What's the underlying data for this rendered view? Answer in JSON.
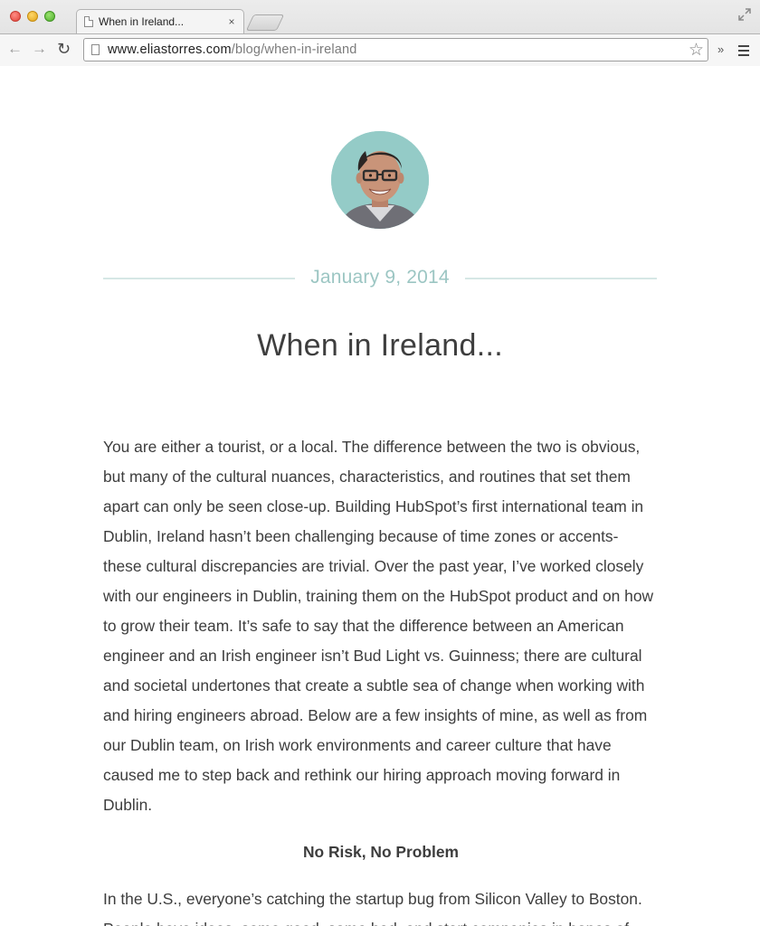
{
  "browser": {
    "tab_title": "When in Ireland...",
    "tab_close": "×",
    "url_domain": "www.eliastorres.com",
    "url_path": "/blog/when-in-ireland",
    "icons": {
      "back": "arrow-left",
      "forward": "arrow-right",
      "reload": "reload",
      "bookmark": "star",
      "extensions": "chevron-double-right",
      "menu": "hamburger",
      "fullscreen": "expand"
    }
  },
  "post": {
    "date": "January 9, 2014",
    "title": "When in Ireland...",
    "paragraphs": [
      "You are either a tourist, or a local. The difference between the two is obvious, but many of the cultural nuances, characteristics, and routines that set them apart can only be seen close-up. Building HubSpot’s first international team in Dublin, Ireland hasn’t been challenging because of time zones or accents- these cultural discrepancies are trivial. Over the past year, I’ve worked closely with our engineers in Dublin, training them on the HubSpot product and on how to grow their team. It’s safe to say that the difference between an American engineer and an Irish engineer isn’t Bud Light vs. Guinness; there are cultural and societal undertones that create a subtle sea of change when working with and hiring engineers abroad. Below are a few insights of mine, as well as from our Dublin team, on Irish work environments and career culture that have caused me to step back and rethink our hiring approach moving forward in Dublin."
    ],
    "section_heading": "No Risk, No Problem",
    "section_paragraph": "In the U.S., everyone’s catching the startup bug from Silicon Valley to Boston. People have ideas, some good, some bad, and start companies in hopes of"
  },
  "colors": {
    "accent": "#9cc6c3",
    "rule": "#d6e7e5",
    "text": "#3d3d3d",
    "avatar_bg": "#94cbc7"
  }
}
